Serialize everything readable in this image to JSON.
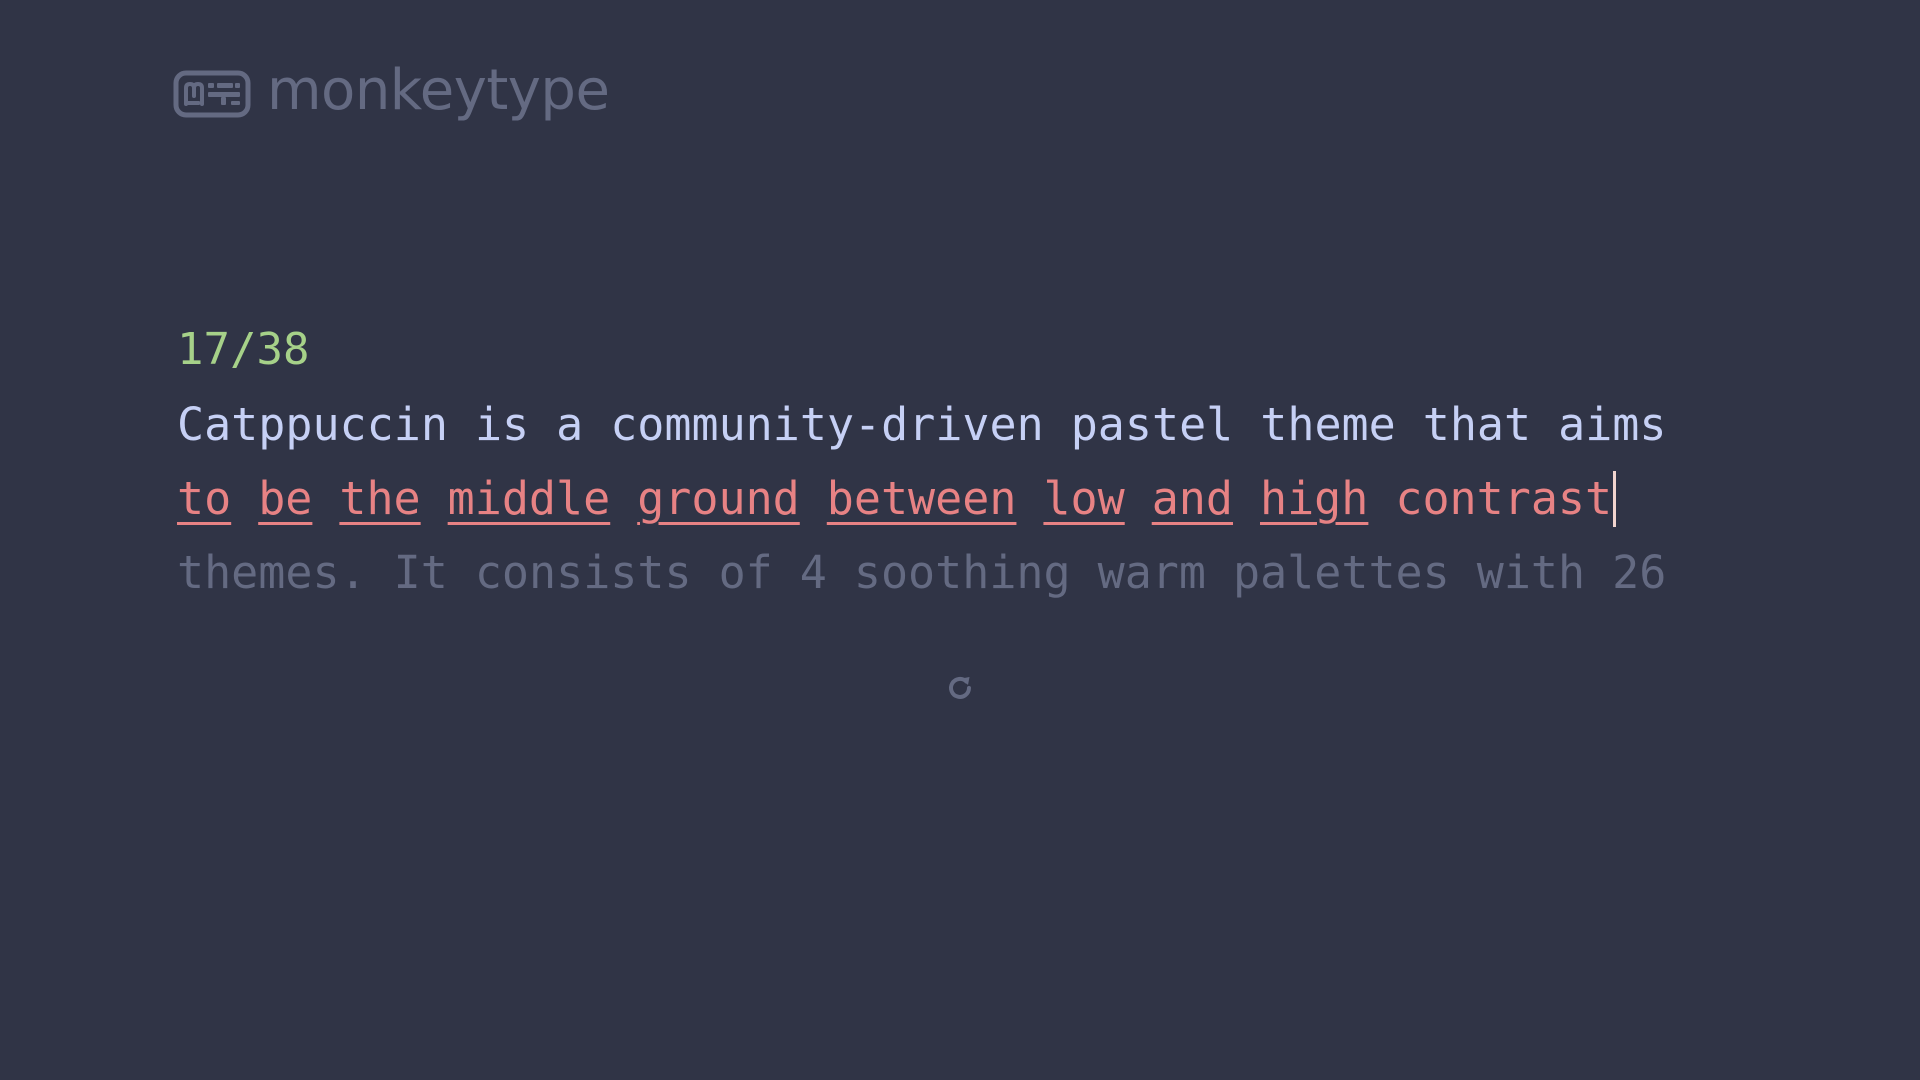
{
  "app": {
    "logo_text": "monkeytype",
    "logo_icon": "keyboard-icon"
  },
  "test": {
    "counter": "17/38",
    "line1": [
      "Catppuccin",
      "is",
      "a",
      "community-driven",
      "pastel",
      "theme",
      "that",
      "aims"
    ],
    "line2_errors": [
      "to",
      "be",
      "the",
      "middle",
      "ground",
      "between",
      "low",
      "and",
      "high"
    ],
    "line2_current": "contrast",
    "line3": [
      "themes.",
      "It",
      "consists",
      "of",
      "4",
      "soothing",
      "warm",
      "palettes",
      "with",
      "26"
    ]
  },
  "controls": {
    "restart_icon": "restart-icon"
  },
  "colors": {
    "background": "#303446",
    "counter": "#a6d189",
    "typed": "#c6d0f5",
    "error": "#e78284",
    "untyped": "#646a82",
    "caret": "#f2d5cf"
  }
}
